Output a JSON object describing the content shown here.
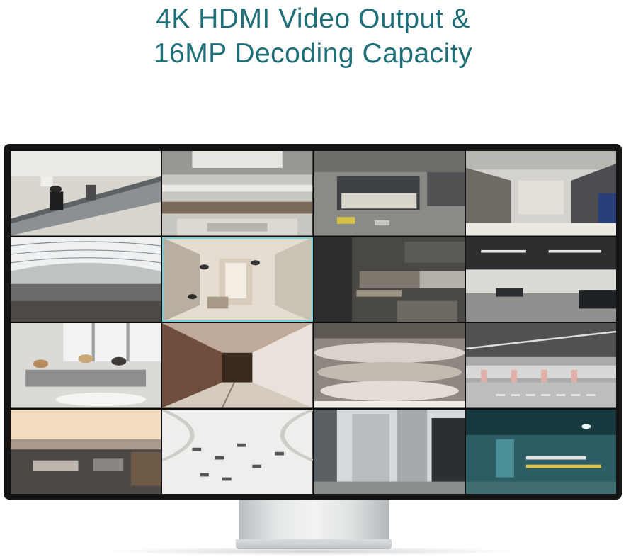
{
  "headline": {
    "line1": "4K HDMI Video Output &",
    "line2": "16MP Decoding Capacity"
  },
  "camera_feeds": [
    {
      "scene": "escalator-with-people"
    },
    {
      "scene": "mall-atrium-upper-view"
    },
    {
      "scene": "aerial-street-plaza"
    },
    {
      "scene": "shopping-mall-corridor"
    },
    {
      "scene": "glass-roof-arcade"
    },
    {
      "scene": "store-interior-topdown",
      "selected": true
    },
    {
      "scene": "outdoor-plaza-stairs"
    },
    {
      "scene": "underground-parking-cars"
    },
    {
      "scene": "office-lounge-people"
    },
    {
      "scene": "long-corridor-arches"
    },
    {
      "scene": "mall-atrium-floors"
    },
    {
      "scene": "parking-garage-lanes"
    },
    {
      "scene": "rooftop-terrace-city"
    },
    {
      "scene": "white-atrium-topdown"
    },
    {
      "scene": "city-skyscrapers-street"
    },
    {
      "scene": "parking-entrance-barrier"
    }
  ],
  "colors": {
    "headline": "#1f6f78",
    "monitor_bezel": "#141414",
    "selected_outline": "#6fd3dd"
  }
}
